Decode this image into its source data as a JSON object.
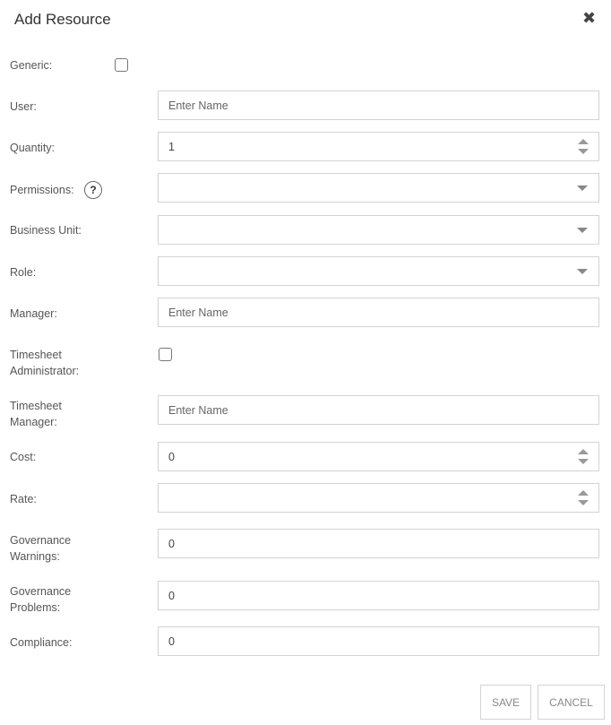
{
  "dialog": {
    "title": "Add Resource",
    "close_icon": "close-icon"
  },
  "fields": {
    "generic": {
      "label": "Generic:",
      "checked": false
    },
    "user": {
      "label": "User:",
      "placeholder": "Enter Name",
      "value": ""
    },
    "quantity": {
      "label": "Quantity:",
      "value": "1"
    },
    "permissions": {
      "label": "Permissions:",
      "help": "?",
      "value": ""
    },
    "business_unit": {
      "label": "Business Unit:",
      "value": ""
    },
    "role": {
      "label": "Role:",
      "value": ""
    },
    "manager": {
      "label": "Manager:",
      "placeholder": "Enter Name",
      "value": ""
    },
    "timesheet_admin": {
      "label_line1": "Timesheet",
      "label_line2": "Administrator:",
      "checked": false
    },
    "timesheet_manager": {
      "label_line1": "Timesheet",
      "label_line2": "Manager:",
      "placeholder": "Enter Name",
      "value": ""
    },
    "cost": {
      "label": "Cost:",
      "value": "0"
    },
    "rate": {
      "label": "Rate:",
      "value": ""
    },
    "gov_warnings": {
      "label_line1": "Governance",
      "label_line2": "Warnings:",
      "value": "0"
    },
    "gov_problems": {
      "label_line1": "Governance",
      "label_line2": "Problems:",
      "value": "0"
    },
    "compliance": {
      "label": "Compliance:",
      "value": "0"
    }
  },
  "buttons": {
    "save": "SAVE",
    "cancel": "CANCEL"
  }
}
